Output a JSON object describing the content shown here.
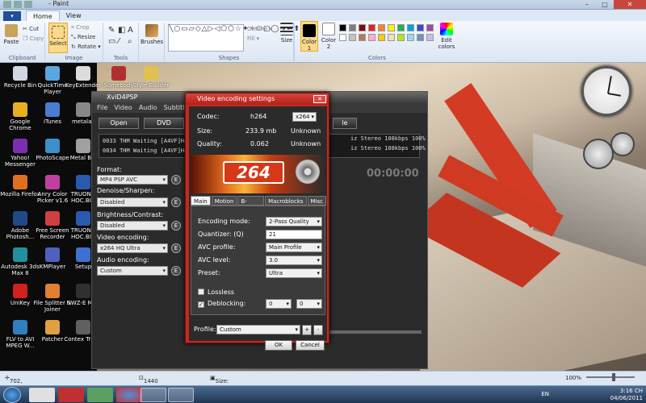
{
  "window": {
    "title": "- Paint",
    "controls": {
      "min": "–",
      "max": "□",
      "close": "✕"
    }
  },
  "ribbon_tabs": [
    {
      "label": "Home"
    },
    {
      "label": "View"
    }
  ],
  "file_button": "▾",
  "ribbon": {
    "clipboard": {
      "label": "Clipboard",
      "paste": "Paste",
      "cut": "Cut",
      "copy": "Copy"
    },
    "image": {
      "label": "Image",
      "select": "Select",
      "crop": "Crop",
      "resize": "Resize",
      "rotate": "Rotate ▾"
    },
    "tools": {
      "label": "Tools"
    },
    "brushes": "Brushes",
    "shapes": {
      "label": "Shapes",
      "outline": "Outline ▾",
      "fill": "Fill ▾"
    },
    "size": "Size",
    "colors": {
      "label": "Colors",
      "color1": "Color 1",
      "color2": "Color 2",
      "edit": "Edit colors"
    }
  },
  "palette": [
    "#000000",
    "#7f7f7f",
    "#880015",
    "#ed1c24",
    "#ff7f27",
    "#fff200",
    "#22b14c",
    "#00a2e8",
    "#3f48cc",
    "#a349a4",
    "#ffffff",
    "#c3c3c3",
    "#b97a57",
    "#ffaec9",
    "#ffc90e",
    "#efe4b0",
    "#b5e61d",
    "#99d9ea",
    "#7092be",
    "#c8bfe7"
  ],
  "desktop_icons": [
    {
      "label": "Recycle Bin",
      "color": "#cfd8e2"
    },
    {
      "label": "QuickTime Player",
      "color": "#5aa6e0"
    },
    {
      "label": "KeyExtender",
      "color": "#dcdcdc"
    },
    {
      "label": "Somebody",
      "color": "#b03030"
    },
    {
      "label": "Style Builder",
      "color": "#e0c050"
    },
    {
      "label": "Google Chrome",
      "color": "#e8b020"
    },
    {
      "label": "iTunes",
      "color": "#4a7cd0"
    },
    {
      "label": "metalas",
      "color": "#888888"
    },
    {
      "label": "Yahoo! Messenger",
      "color": "#7b2fb0"
    },
    {
      "label": "PhotoScape",
      "color": "#3a90c8"
    },
    {
      "label": "Metal Bla",
      "color": "#a0a0a0"
    },
    {
      "label": "Mozilla Firefox",
      "color": "#e07020"
    },
    {
      "label": "Anry Color Picker v1.6",
      "color": "#c040a0"
    },
    {
      "label": "TRUONG HOC.BIN",
      "color": "#2a5ab0"
    },
    {
      "label": "Adobe Photosh...",
      "color": "#1f4a8a"
    },
    {
      "label": "Free Screen Recorder",
      "color": "#d04040"
    },
    {
      "label": "TRUONG HOC.BIN",
      "color": "#2a5ab0"
    },
    {
      "label": "Autodesk 3ds Max 8",
      "color": "#2090a0"
    },
    {
      "label": "KMPlayer",
      "color": "#5060c0"
    },
    {
      "label": "Setup",
      "color": "#4070d0"
    },
    {
      "label": "UniKey",
      "color": "#d02020"
    },
    {
      "label": "File Splitter & Joiner",
      "color": "#e08030"
    },
    {
      "label": "NWZ-E MP4",
      "color": "#303030"
    },
    {
      "label": "FLV to AVI MPEG W...",
      "color": "#3080c0"
    },
    {
      "label": "Patcher",
      "color": "#e0a040"
    },
    {
      "label": "Contex Transl",
      "color": "#606060"
    }
  ],
  "xvid": {
    "title": "XviD4PSP",
    "menu": [
      "File",
      "Video",
      "Audio",
      "Subtitles",
      "A"
    ],
    "open": "Open",
    "dvd": "DVD",
    "queue": [
      "0033  THM  Waiting  [A4VF]Ha",
      "0034  THM  Waiting  [A4VF]Ha"
    ],
    "queue_right": [
      "iz  Stereo  108kbps  100%",
      "iz  Stereo  108kbps  100%"
    ],
    "timer": "00:00:00",
    "format_label": "Format:",
    "format_value": "MP4 PSP AVC",
    "denoise_label": "Denoise/Sharpen:",
    "denoise_value": "Disabled",
    "bright_label": "Brightness/Contrast:",
    "bright_value": "Disabled",
    "venc_label": "Video encoding:",
    "venc_value": "x264 HQ Ultra",
    "aenc_label": "Audio encoding:",
    "aenc_value": "Custom",
    "e": "E",
    "topright_btn": "le"
  },
  "dialog": {
    "title": "Video encoding settings",
    "codec_label": "Codec:",
    "codec_value": "h264",
    "codec_select": "x264",
    "size_label": "Size:",
    "size_value": "233.9 mb",
    "size_right": "Unknown",
    "quality_label": "Quality:",
    "quality_value": "0.062",
    "quality_right": "Unknown",
    "logo": "264",
    "tabs": [
      {
        "label": "Main"
      },
      {
        "label": "Motion"
      },
      {
        "label": "B-frames"
      },
      {
        "label": "Macroblocks"
      },
      {
        "label": "Misc"
      }
    ],
    "mode_label": "Encoding mode:",
    "mode_value": "2-Pass Quality",
    "quant_label": "Quantizer: (Q)",
    "quant_value": "21",
    "profile_label": "AVC profile:",
    "profile_value": "Main Profile",
    "level_label": "AVC level:",
    "level_value": "3.0",
    "preset_label": "Preset:",
    "preset_value": "Ultra",
    "lossless_label": "Lossless",
    "deblock_label": "Deblocking:",
    "deblock_a": "0",
    "deblock_b": "0",
    "profile_bottom_label": "Profile:",
    "profile_bottom_value": "Custom",
    "plus": "+",
    "minus": "-",
    "ok": "OK",
    "cancel": "Cancel"
  },
  "status": {
    "pos": "702, 5px",
    "dims": "1440 × 900px",
    "size": "Size: 1,4MB",
    "zoom": "100%"
  },
  "tray": {
    "lang": "EN",
    "time": "3:16 CH",
    "date": "04/06/2011"
  }
}
